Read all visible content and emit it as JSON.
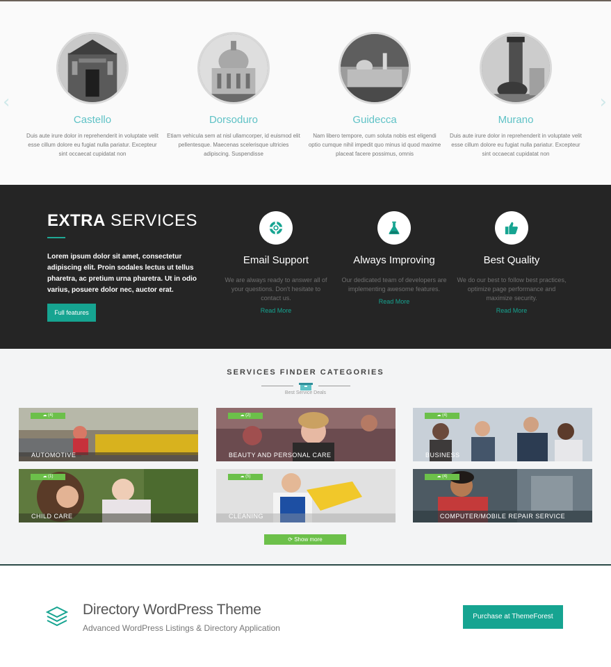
{
  "neighborhoods": {
    "prev_arrow": "‹",
    "next_arrow": "›",
    "items": [
      {
        "title": "Castello",
        "desc": "Duis aute irure dolor in reprehenderit in voluptate velit esse cillum dolore eu fugiat nulla pariatur. Excepteur sint occaecat cupidatat non"
      },
      {
        "title": "Dorsoduro",
        "desc": "Etiam vehicula sem at nisl ullamcorper, id euismod elit pellentesque. Maecenas scelerisque ultricies adipiscing. Suspendisse"
      },
      {
        "title": "Guidecca",
        "desc": "Nam libero tempore, cum soluta nobis est eligendi optio cumque nihil impedit quo minus id quod maxime placeat facere possimus, omnis"
      },
      {
        "title": "Murano",
        "desc": "Duis aute irure dolor in reprehenderit in voluptate velit esse cillum dolore eu fugiat nulla pariatur. Excepteur sint occaecat cupidatat non"
      }
    ]
  },
  "extra": {
    "title_bold": "EXTRA",
    "title_light": "SERVICES",
    "desc": "Lorem ipsum dolor sit amet, consectetur adipiscing elit. Proin sodales lectus ut tellus pharetra, ac pretium urna pharetra. Ut in odio varius, posuere dolor nec, auctor erat.",
    "button": "Full features",
    "services": [
      {
        "title": "Email Support",
        "desc": "We are always ready to answer all of your questions. Don't hesitate to contact us.",
        "link": "Read More",
        "icon": "lifebuoy-icon"
      },
      {
        "title": "Always Improving",
        "desc": "Our dedicated team of developers are implementing awesome features.",
        "link": "Read More",
        "icon": "flask-icon"
      },
      {
        "title": "Best Quality",
        "desc": "We do our best to follow best practices, optimize page performance and maximize security.",
        "link": "Read More",
        "icon": "thumbs-up-icon"
      }
    ]
  },
  "categories": {
    "heading": "SERVICES FINDER CATEGORIES",
    "subheading": "Best Service Deals",
    "show_more": "⟳ Show more",
    "items": [
      {
        "label": "AUTOMOTIVE",
        "count": "☁ (4)"
      },
      {
        "label": "BEAUTY AND PERSONAL CARE",
        "count": "☁ (2)"
      },
      {
        "label": "BUSINESS",
        "count": "☁ (4)"
      },
      {
        "label": "CHILD CARE",
        "count": "☁ (1)"
      },
      {
        "label": "CLEANING",
        "count": "☁ (5)"
      },
      {
        "label": "COMPUTER/MOBILE REPAIR SERVICE",
        "count": "☁ (4)"
      }
    ]
  },
  "footer": {
    "title": "Directory WordPress Theme",
    "subtitle": "Advanced WordPress Listings & Directory Application",
    "button": "Purchase at ThemeForest"
  },
  "colors": {
    "accent": "#16a491",
    "green": "#6cc04a",
    "title_cyan": "#5fc2c6",
    "dark": "#252525"
  }
}
